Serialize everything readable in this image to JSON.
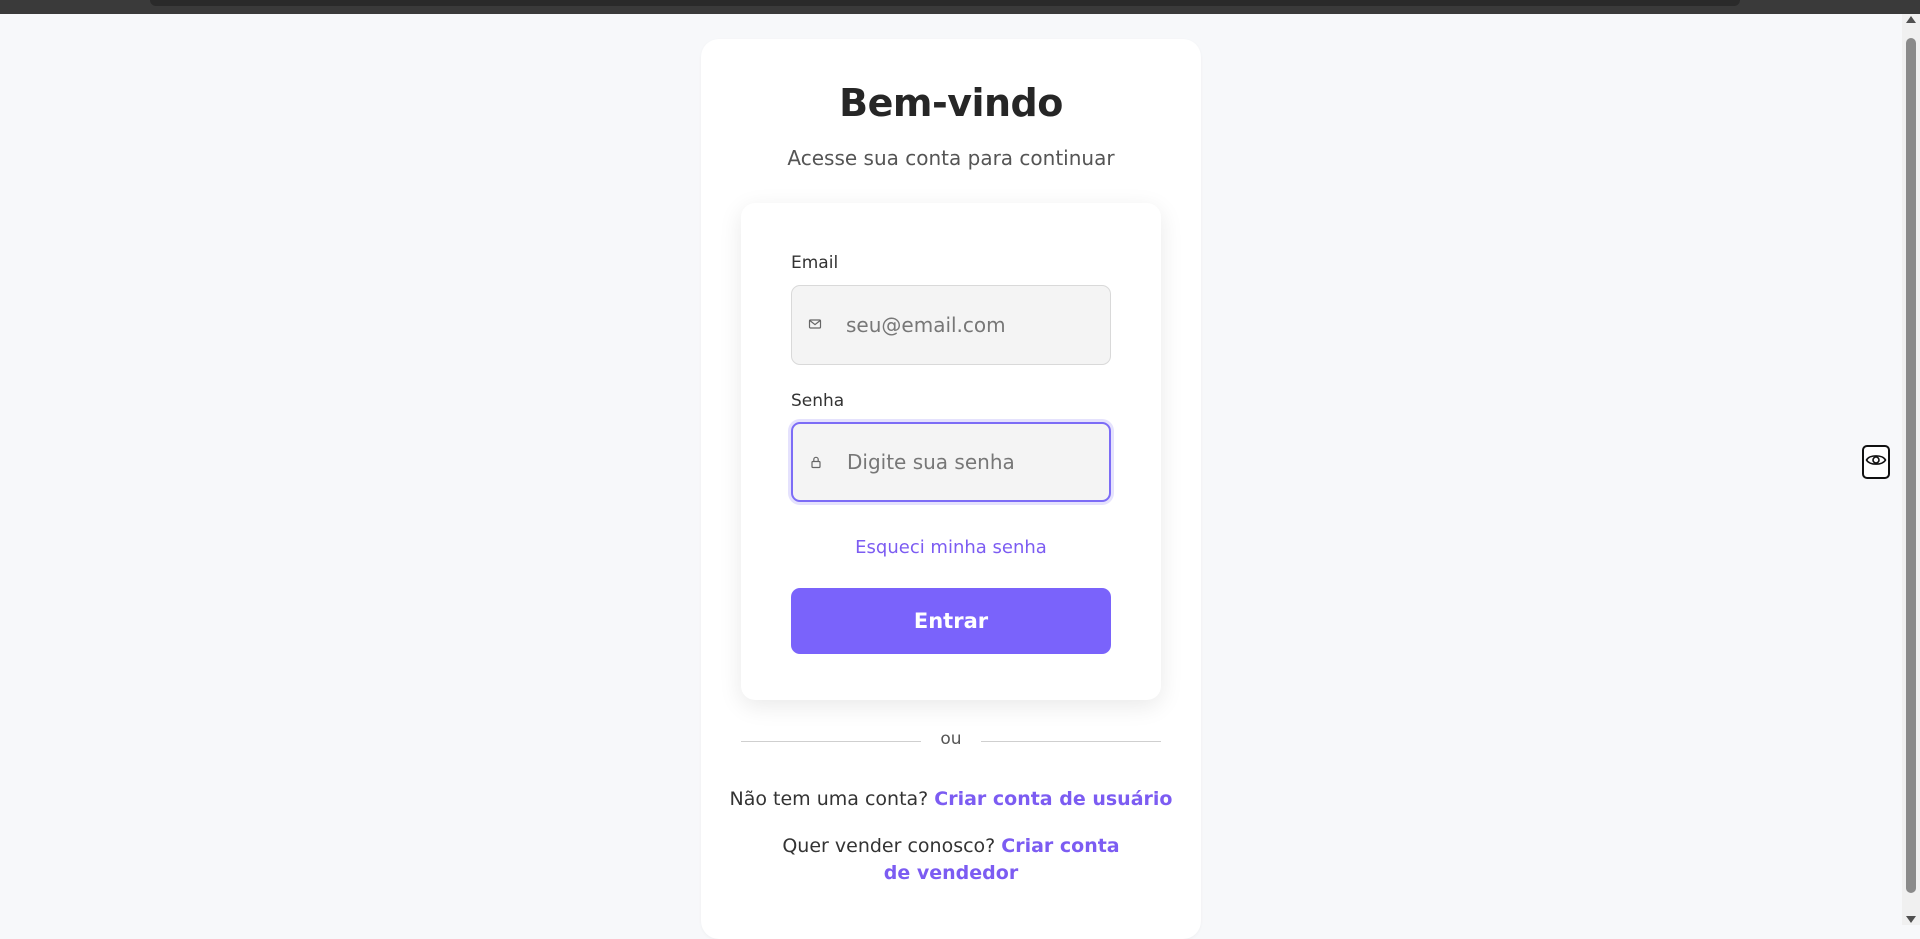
{
  "header": {
    "title": "Bem-vindo",
    "subtitle": "Acesse sua conta para continuar"
  },
  "form": {
    "email_label": "Email",
    "email_placeholder": "seu@email.com",
    "email_value": "",
    "password_label": "Senha",
    "password_placeholder": "Digite sua senha",
    "password_value": "",
    "forgot_link": "Esqueci minha senha",
    "submit_label": "Entrar"
  },
  "divider": {
    "text": "ou"
  },
  "signup": {
    "user_prompt": "Não tem uma conta?",
    "user_link": "Criar conta de usuário",
    "seller_prompt": "Quer vender conosco?",
    "seller_link": "Criar conta de vendedor"
  },
  "icons": {
    "email": "mail-icon",
    "password": "lock-icon",
    "toggle": "eye-icon"
  },
  "colors": {
    "accent": "#7a63fb",
    "link": "#7c5cf2",
    "background": "#f7f8fa"
  }
}
